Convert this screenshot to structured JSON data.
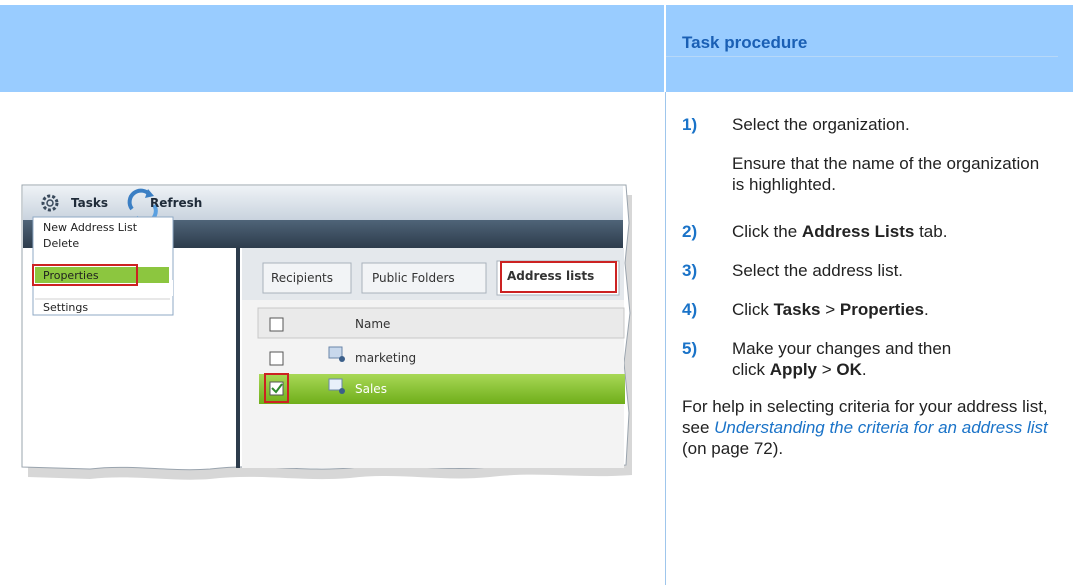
{
  "header": {
    "title": "Task procedure"
  },
  "screenshot": {
    "toolbar": {
      "tasks": "Tasks",
      "refresh": "Refresh"
    },
    "menu": [
      "New Address List",
      "Delete",
      "Properties",
      "Settings"
    ],
    "tabs": [
      "Recipients",
      "Public Folders",
      "Address lists"
    ],
    "column_name": "Name",
    "rows": [
      {
        "name": "marketing",
        "checked": false,
        "selected": false
      },
      {
        "name": "Sales",
        "checked": true,
        "selected": true
      }
    ]
  },
  "steps": [
    {
      "num": "1)",
      "text": "Select the organization."
    },
    {
      "num": "2)",
      "pre": "Click the ",
      "bold": "Address Lists",
      "post": " tab."
    },
    {
      "num": "3)",
      "text": "Select the address list."
    },
    {
      "num": "4)",
      "pre": "Click ",
      "b1": "Tasks",
      "mid": " > ",
      "b2": "Properties",
      "post": "."
    },
    {
      "num": "5)",
      "line1": "Make your changes and then",
      "pre": "click ",
      "b1": "Apply",
      "mid": " > ",
      "b2": "OK",
      "post": "."
    }
  ],
  "note": "Ensure that the name of the organization is highlighted.",
  "help": {
    "pre": "For help in selecting criteria for your address list, see",
    "link": "Understanding the criteria for an address list",
    "post": " (on page 72)."
  }
}
